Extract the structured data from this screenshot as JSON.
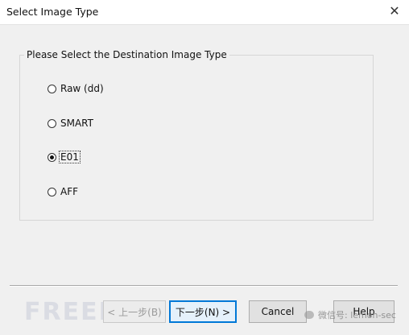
{
  "window": {
    "title": "Select Image Type",
    "close_glyph": "✕"
  },
  "group": {
    "label": "Please Select the Destination Image Type",
    "options": [
      {
        "label": "Raw (dd)",
        "checked": false
      },
      {
        "label": "SMART",
        "checked": false
      },
      {
        "label": "E01",
        "checked": true
      },
      {
        "label": "AFF",
        "checked": false
      }
    ]
  },
  "buttons": {
    "back": "< 上一步(B)",
    "next": "下一步(N) >",
    "cancel": "Cancel",
    "help": "Help"
  },
  "watermark": {
    "left": "FREEBUF",
    "right": "微信号: lemon-sec"
  }
}
